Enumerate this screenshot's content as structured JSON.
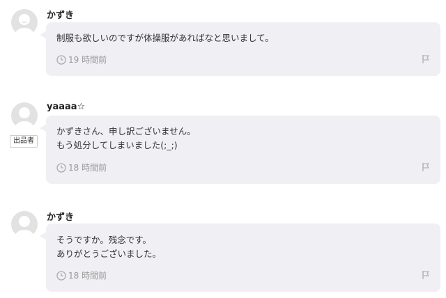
{
  "comments": [
    {
      "user": "かずき",
      "seller_badge": "",
      "text": "制服も欲しいのですが体操服があればなと思いまして。",
      "time": "19 時間前"
    },
    {
      "user": "yaaaa☆",
      "seller_badge": "出品者",
      "text": "かずきさん、申し訳ございません。\nもう処分してしまいました(;_;)",
      "time": "18 時間前"
    },
    {
      "user": "かずき",
      "seller_badge": "",
      "text": "そうですか。残念です。\nありがとうございました。",
      "time": "18 時間前"
    }
  ],
  "icons": {
    "avatar": "default-user-icon",
    "time": "clock-icon",
    "report": "flag-icon"
  },
  "colors": {
    "bubble_bg": "#efeff4",
    "avatar_bg": "#e2e2e2",
    "muted_text": "#999999"
  }
}
